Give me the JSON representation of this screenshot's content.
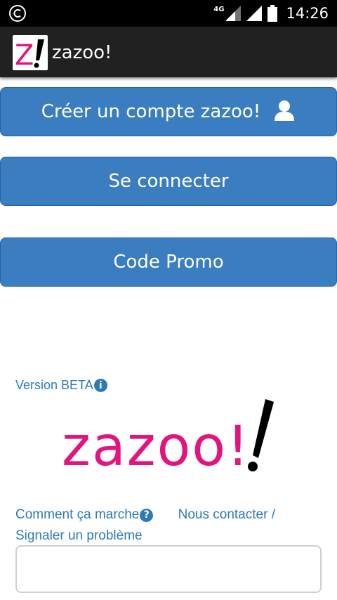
{
  "status_bar": {
    "network_label": "4G",
    "time": "14:26",
    "colors": {
      "background": "#000000",
      "foreground": "#ffffff"
    }
  },
  "app_bar": {
    "title": "zazoo!",
    "logo_letter": "Z",
    "logo_icon": "zazoo-logo-icon",
    "background": "#212121"
  },
  "buttons": {
    "create_account": "Créer un compte zazoo!",
    "login": "Se connecter",
    "promo_code": "Code Promo",
    "color": "#3a7dc0"
  },
  "version": {
    "label": "Version BETA",
    "info_icon_glyph": "i"
  },
  "big_logo": {
    "text": "zazoo!",
    "color": "#e4147f"
  },
  "links": {
    "how_it_works": "Comment ça marche",
    "help_icon_glyph": "?",
    "contact": "Nous contacter /",
    "report_problem": "Signaler un problème",
    "color": "#2e7ab7"
  },
  "report_field": {
    "value": "",
    "placeholder": ""
  }
}
